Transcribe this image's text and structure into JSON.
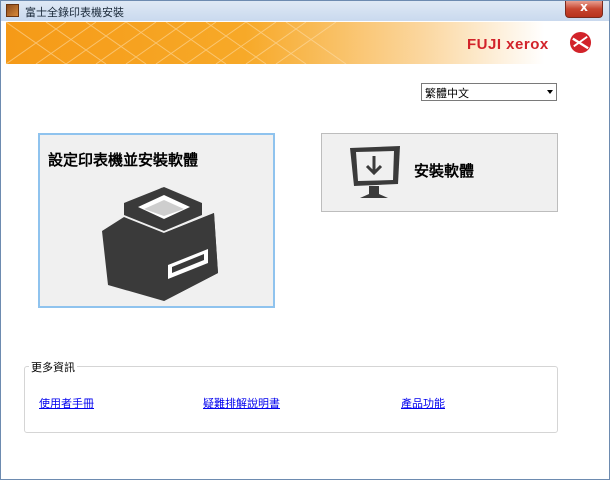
{
  "window": {
    "title": "富士全錄印表機安裝",
    "close_symbol": "x"
  },
  "banner": {
    "logo_text": "FUJI xerox",
    "logo_icon": "xerox-ball-icon"
  },
  "language": {
    "selected": "繁體中文"
  },
  "actions": {
    "setup_printer_label": "設定印表機並安裝軟體",
    "install_software_label": "安裝軟體"
  },
  "more_info": {
    "legend": "更多資訊",
    "links": [
      "使用者手冊",
      "疑難排解說明書",
      "產品功能"
    ]
  },
  "colors": {
    "banner_orange": "#f59a17",
    "brand_red": "#d2232a",
    "link": "#0000ee",
    "focus_border": "#8fc3ee"
  }
}
